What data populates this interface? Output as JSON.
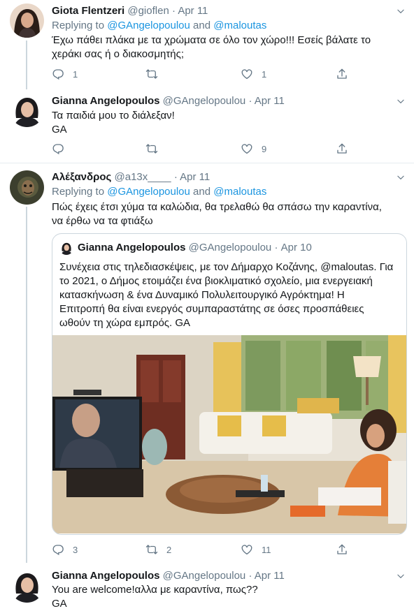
{
  "tweets": [
    {
      "name": "Giota Flentzeri",
      "handle": "@gioflen",
      "sep": "·",
      "date": "Apr 11",
      "reply_prefix": "Replying to",
      "reply_user1": "@GAngelopoulou",
      "reply_and": "and",
      "reply_user2": "@maloutas",
      "text1": "Έχω πάθει πλάκα με τα χρώματα σε όλο τον χώρο!!! Εσείς βάλατε το",
      "text2": "χεράκι σας ή ο διακοσμητής;",
      "replies": "1",
      "retweets": "",
      "likes": "1"
    },
    {
      "name": "Gianna Angelopoulos",
      "handle": "@GAngelopoulou",
      "sep": "·",
      "date": "Apr 11",
      "text1": "Τα παιδιά μου το διάλεξαν!",
      "text2": "GA",
      "replies": "",
      "retweets": "",
      "likes": "9"
    },
    {
      "name": "Αλέξανδρος",
      "handle": "@a13x____",
      "sep": "·",
      "date": "Apr 11",
      "reply_prefix": "Replying to",
      "reply_user1": "@GAngelopoulou",
      "reply_and": "and",
      "reply_user2": "@maloutas",
      "text1": "Πώς έχεις έτσι χύμα τα καλώδια, θα τρελαθώ θα σπάσω την καραντίνα,",
      "text2": "να έρθω να τα φτιάξω",
      "replies": "3",
      "retweets": "2",
      "likes": "11",
      "quote": {
        "name": "Gianna Angelopoulos",
        "handle": "@GAngelopoulou",
        "sep": "·",
        "date": "Apr 10",
        "lines": [
          "Συνέχεια στις τηλεδιασκέψεις, με τον Δήμαρχο Κοζάνης, @maloutas. Για",
          "το 2021, ο Δήμος ετοιμάζει ένα βιοκλιματικό σχολείο, μια ενεργειακή",
          "κατασκήνωση & ένα Δυναμικό Πολυλειτουργικό Αγρόκτημα! Η",
          "Επιτροπή θα είναι ενεργός συμπαραστάτης σε όσες προσπάθειες",
          "ωθούν τη χώρα εμπρός. GA"
        ]
      }
    },
    {
      "name": "Gianna Angelopoulos",
      "handle": "@GAngelopoulou",
      "sep": "·",
      "date": "Apr 11",
      "text1": "You are welcome!αλλα με καραντίνα, πως??",
      "text2": "GA"
    }
  ],
  "icons": {
    "reply": "reply-icon",
    "retweet": "retweet-icon",
    "like": "heart-icon",
    "share": "share-icon",
    "more": "chevron-down-icon"
  },
  "colors": {
    "link": "#1b95e0",
    "muted": "#657786",
    "border": "#e6ecf0"
  }
}
